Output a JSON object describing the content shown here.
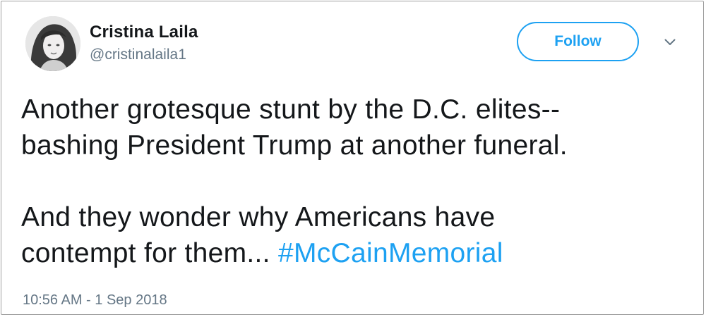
{
  "tweet": {
    "author_name": "Cristina Laila",
    "author_handle": "@cristinalaila1",
    "follow_label": "Follow",
    "body_lines": [
      "Another grotesque stunt by the D.C. elites--",
      "bashing President Trump at another funeral.",
      "And they wonder why Americans have",
      "contempt for them... "
    ],
    "hashtag": "#McCainMemorial",
    "timestamp": "10:56 AM - 1 Sep 2018"
  },
  "icons": {
    "avatar": "profile-photo",
    "menu": "chevron-down-icon"
  },
  "colors": {
    "accent": "#1da1f2",
    "text": "#14171a",
    "muted": "#657786",
    "border": "#9e9e9e"
  }
}
